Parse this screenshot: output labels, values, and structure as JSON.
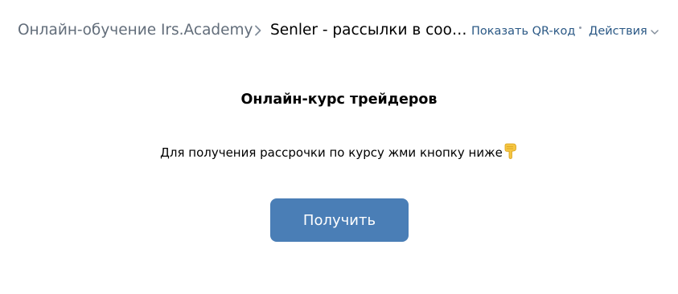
{
  "header": {
    "breadcrumb_root": "Онлайн-обучение Irs.Academy",
    "breadcrumb_current": "Senler - рассылки в сообщениях",
    "qr_link": "Показать QR-код",
    "actions_label": "Действия"
  },
  "main": {
    "title": "Онлайн-курс трейдеров",
    "description": "Для получения рассрочки по курсу жми кнопку ниже",
    "description_icon": "pointing-down-hand-icon",
    "button_label": "Получить"
  },
  "colors": {
    "link": "#2a5885",
    "muted": "#626d7a",
    "button": "#4a7eb6",
    "button_text": "#ffffff"
  }
}
